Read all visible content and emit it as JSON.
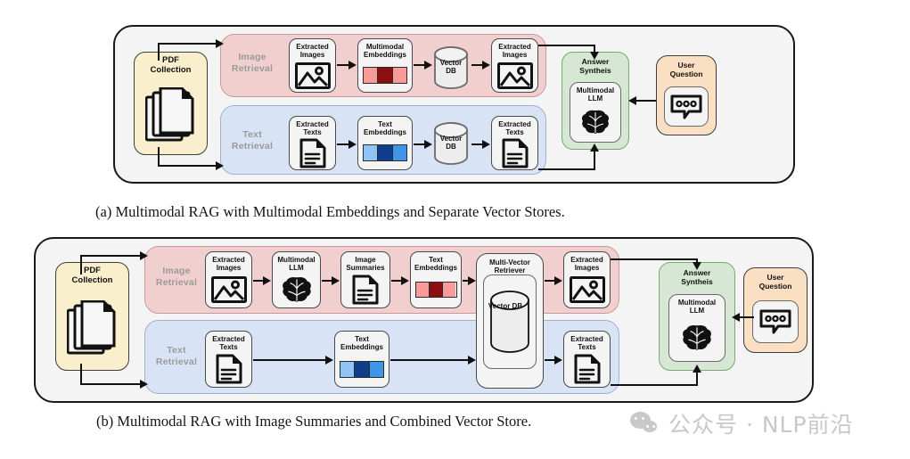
{
  "figure": {
    "watermark": {
      "text": "公众号 · NLP前沿",
      "icon": "wechat-icon"
    },
    "colors": {
      "outer_bg": "#f4f4f4",
      "image_lane": "#f2cfcf",
      "text_lane": "#d8e4f5",
      "pdf_box": "#faefcd",
      "answer_box": "#d6e8d3",
      "user_box": "#fbdfc2",
      "image_embed_dark": "#8b0f0f",
      "image_embed_light": "#fb9a9a",
      "text_embed_dark": "#0f3f8b",
      "text_embed_light": "#6fb4ef"
    }
  },
  "panel_a": {
    "caption": "(a) Multimodal RAG with Multimodal Embeddings and Separate Vector Stores.",
    "source": {
      "label": "PDF\nCollection",
      "label_line1": "PDF",
      "label_line2": "Collection",
      "icon": "documents-stack-icon"
    },
    "image_lane": {
      "label_line1": "Image",
      "label_line2": "Retrieval",
      "nodes": [
        {
          "label_line1": "Extracted",
          "label_line2": "Images",
          "icon": "picture-icon"
        },
        {
          "label_line1": "Multimodal",
          "label_line2": "Embeddings",
          "icon": "embedding-bar-icon"
        },
        {
          "label_line1": "Vector",
          "label_line2": "DB",
          "icon": "database-cylinder-icon"
        },
        {
          "label_line1": "Extracted",
          "label_line2": "Images",
          "icon": "picture-icon"
        }
      ]
    },
    "text_lane": {
      "label_line1": "Text",
      "label_line2": "Retrieval",
      "nodes": [
        {
          "label_line1": "Extracted",
          "label_line2": "Texts",
          "icon": "document-icon"
        },
        {
          "label_line1": "Text",
          "label_line2": "Embeddings",
          "icon": "embedding-bar-icon"
        },
        {
          "label_line1": "Vector",
          "label_line2": "DB",
          "icon": "database-cylinder-icon"
        },
        {
          "label_line1": "Extracted",
          "label_line2": "Texts",
          "icon": "document-icon"
        }
      ]
    },
    "answer": {
      "label_line1": "Answer",
      "label_line2": "Syntheis",
      "inner": {
        "label_line1": "Multimodal",
        "label_line2": "LLM",
        "icon": "brain-icon"
      }
    },
    "user": {
      "label_line1": "User",
      "label_line2": "Question",
      "icon": "chat-bubble-icon"
    }
  },
  "panel_b": {
    "caption": "(b) Multimodal RAG with Image Summaries and Combined Vector Store.",
    "source": {
      "label_line1": "PDF",
      "label_line2": "Collection",
      "icon": "documents-stack-icon"
    },
    "image_lane": {
      "label_line1": "Image",
      "label_line2": "Retrieval",
      "nodes": [
        {
          "label_line1": "Extracted",
          "label_line2": "Images",
          "icon": "picture-icon"
        },
        {
          "label_line1": "Multimodal",
          "label_line2": "LLM",
          "icon": "brain-icon"
        },
        {
          "label_line1": "Image",
          "label_line2": "Summaries",
          "icon": "document-icon"
        },
        {
          "label_line1": "Text",
          "label_line2": "Embeddings",
          "icon": "embedding-bar-icon"
        },
        {
          "label_line1": "Extracted",
          "label_line2": "Images",
          "icon": "picture-icon"
        }
      ]
    },
    "text_lane": {
      "label_line1": "Text",
      "label_line2": "Retrieval",
      "nodes": [
        {
          "label_line1": "Extracted",
          "label_line2": "Texts",
          "icon": "document-icon"
        },
        {
          "label_line1": "Text",
          "label_line2": "Embeddings",
          "icon": "embedding-bar-icon"
        },
        {
          "label_line1": "Extracted",
          "label_line2": "Texts",
          "icon": "document-icon"
        }
      ]
    },
    "retriever": {
      "label_line1": "Multi-Vector",
      "label_line2": "Retriever",
      "inner_label": "Vector DB",
      "icon": "database-cylinder-icon"
    },
    "answer": {
      "label_line1": "Answer",
      "label_line2": "Syntheis",
      "inner": {
        "label_line1": "Multimodal",
        "label_line2": "LLM",
        "icon": "brain-icon"
      }
    },
    "user": {
      "label_line1": "User",
      "label_line2": "Question",
      "icon": "chat-bubble-icon"
    }
  }
}
